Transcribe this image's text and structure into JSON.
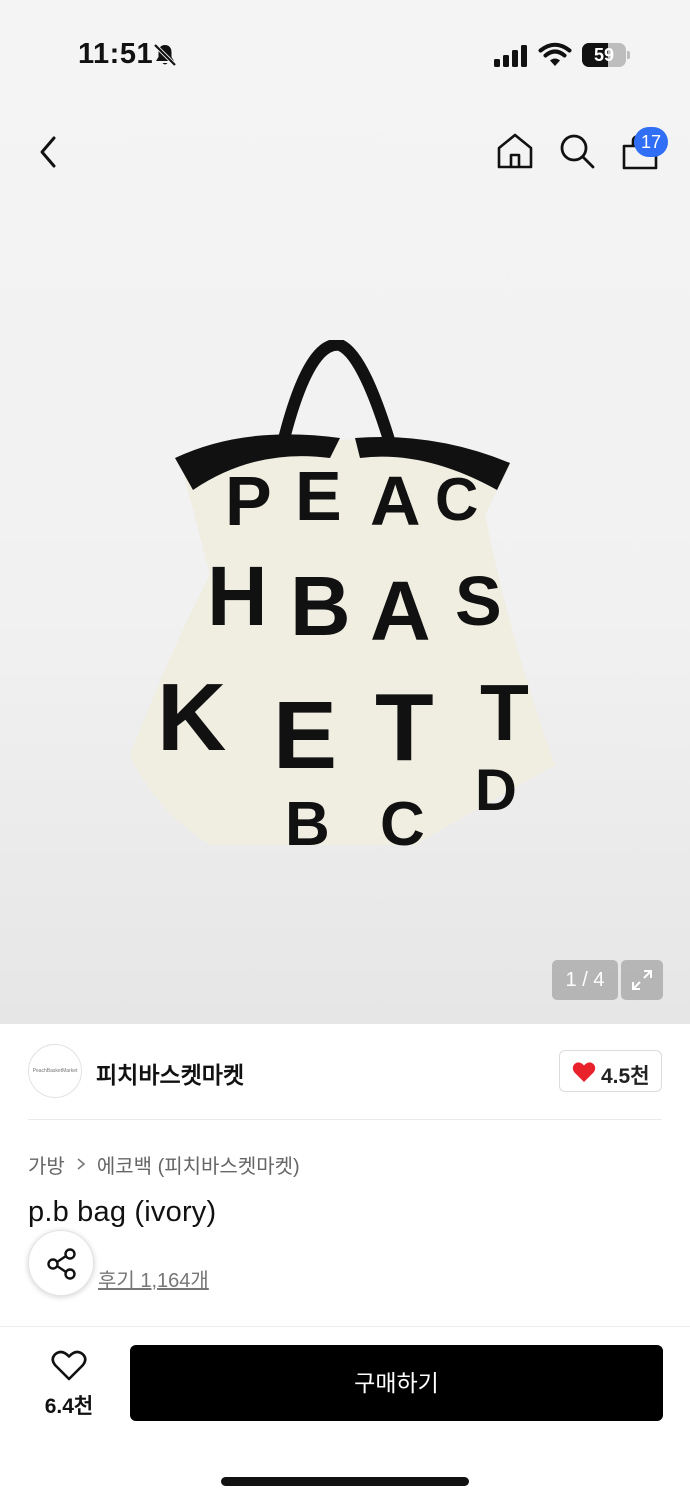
{
  "status_bar": {
    "time": "11:51",
    "battery": "59",
    "battery_level": 0.59
  },
  "header": {
    "icons": [
      "back-icon",
      "home-icon",
      "search-icon",
      "cart-icon"
    ],
    "cart_count": "17"
  },
  "gallery": {
    "counter": "1 / 4",
    "current": 1,
    "total": 4,
    "image_description_icon": "product-photo"
  },
  "brand": {
    "logo_text": "PeachBasketMarket",
    "name": "피치바스켓마켓",
    "likes": "4.5천",
    "like_color": "#e8212b"
  },
  "breadcrumb": {
    "items": [
      "가방",
      "에코백 (피치바스켓마켓)"
    ]
  },
  "product": {
    "title": "p.b bag (ivory)",
    "reviews": "후기 1,164개"
  },
  "bottom_bar": {
    "wish_count": "6.4천",
    "buy_label": "구매하기"
  },
  "colors": {
    "accent_badge": "#2f6ef5",
    "buy_button": "#000000"
  }
}
